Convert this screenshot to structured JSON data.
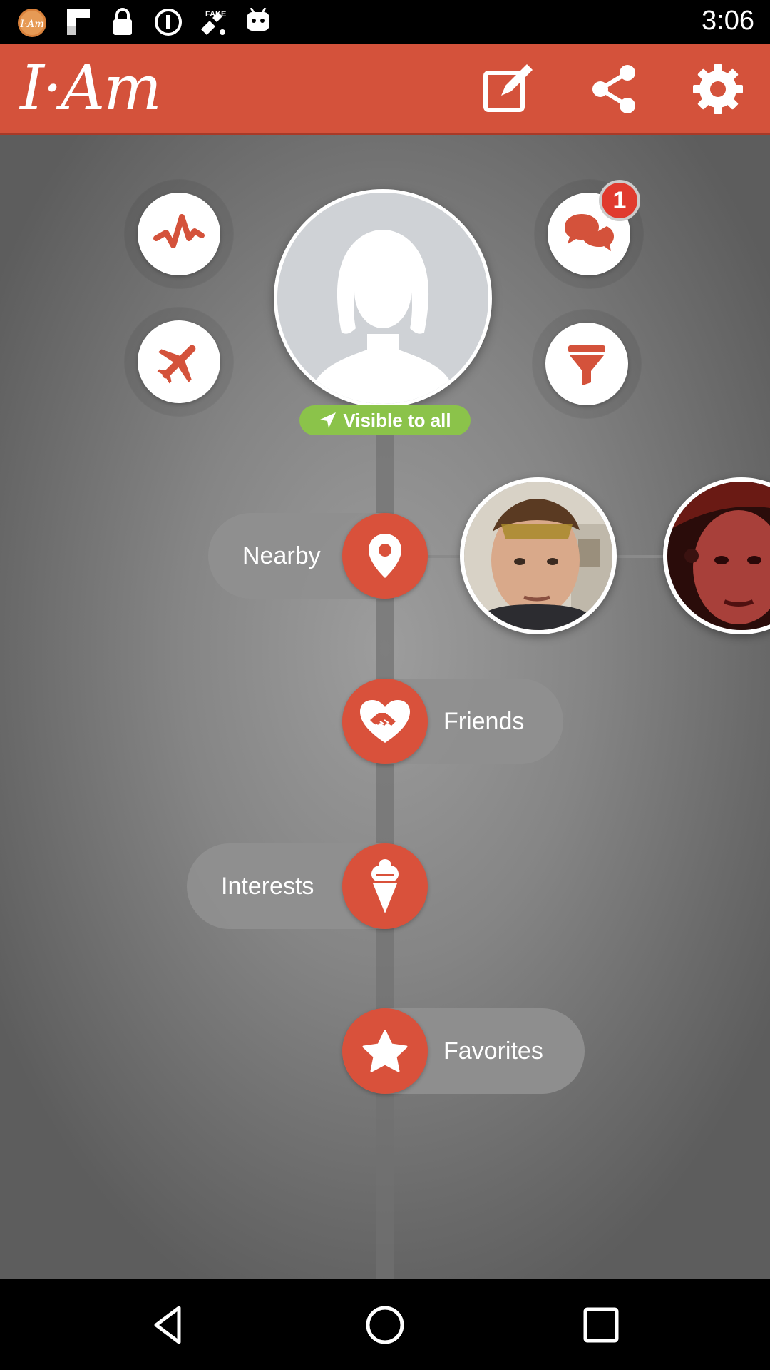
{
  "status_bar": {
    "time": "3:06",
    "icons": [
      "app-logo-icon",
      "flipboard-icon",
      "lock-icon",
      "info-icon",
      "fake-gps-icon",
      "android-icon"
    ]
  },
  "header": {
    "logo_text": "I·Am",
    "buttons": [
      "edit-icon",
      "share-icon",
      "settings-icon"
    ]
  },
  "quick_actions": {
    "activity": "activity-icon",
    "travel": "airplane-icon",
    "messages": "chat-icon",
    "messages_badge": "1",
    "filter": "filter-icon"
  },
  "profile": {
    "visibility_label": "Visible to all"
  },
  "menu": {
    "nearby": "Nearby",
    "friends": "Friends",
    "interests": "Interests",
    "favorites": "Favorites"
  },
  "colors": {
    "accent": "#d4523b",
    "visible_green": "#8bc34a",
    "badge_red": "#e03a2e"
  }
}
